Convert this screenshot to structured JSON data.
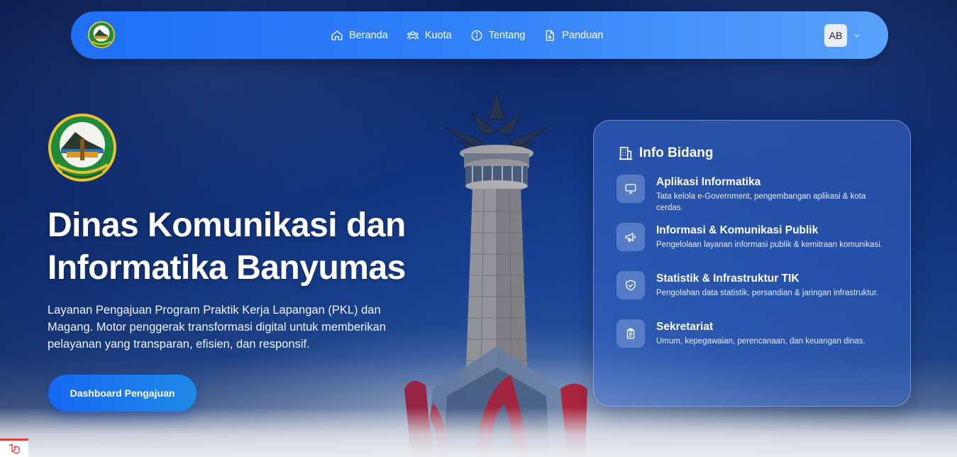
{
  "navbar": {
    "links": [
      {
        "label": "Beranda",
        "icon": "home-icon"
      },
      {
        "label": "Kuota",
        "icon": "users-icon"
      },
      {
        "label": "Tentang",
        "icon": "info-icon"
      },
      {
        "label": "Panduan",
        "icon": "document-icon"
      }
    ],
    "avatar_initials": "AB",
    "colors": {
      "start": "#1f6ff5",
      "end": "#58a2fb"
    }
  },
  "hero": {
    "title_line1": "Dinas Komunikasi dan",
    "title_line2": "Informatika Banyumas",
    "description": "Layanan Pengajuan Program Praktik Kerja Lapangan (PKL) dan Magang. Motor penggerak transformasi digital untuk memberikan pelayanan yang transparan, efisien, dan responsif.",
    "cta_label": "Dashboard Pengajuan"
  },
  "info": {
    "title": "Info Bidang",
    "items": [
      {
        "title": "Aplikasi Informatika",
        "desc": "Tata kelola e-Government, pengembangan aplikasi & kota cerdas.",
        "icon": "monitor-icon"
      },
      {
        "title": "Informasi & Komunikasi Publik",
        "desc": "Pengelolaan layanan informasi publik & kemitraan komunikasi.",
        "icon": "megaphone-icon"
      },
      {
        "title": "Statistik & Infrastruktur TIK",
        "desc": "Pengolahan data statistik, persandian & jaringan infrastruktur.",
        "icon": "shield-check-icon"
      },
      {
        "title": "Sekretariat",
        "desc": "Umum, kepegawaian, perencanaan, dan keuangan dinas.",
        "icon": "clipboard-icon"
      }
    ]
  }
}
